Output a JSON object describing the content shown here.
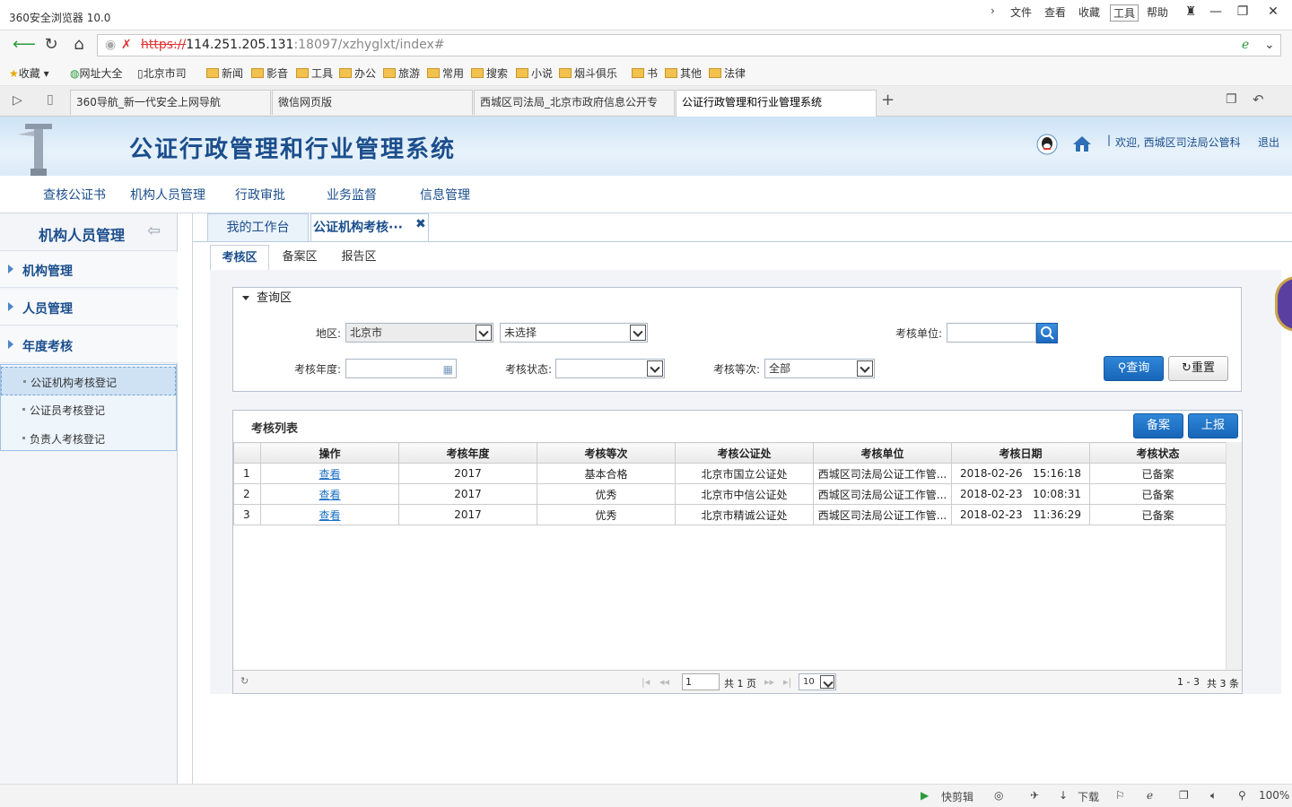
{
  "browser": {
    "title": "360安全浏览器 10.0",
    "menu": [
      "文件",
      "查看",
      "收藏",
      "工具",
      "帮助"
    ],
    "url_scheme": "https://",
    "url_host": "114.251.205.131",
    "url_rest": ":18097/xzhyglxt/index#",
    "bookmarks": [
      "收藏",
      "网址大全",
      "北京市司",
      "新闻",
      "影音",
      "工具",
      "办公",
      "旅游",
      "常用",
      "搜索",
      "小说",
      "烟斗俱乐",
      "书",
      "其他",
      "法律"
    ],
    "tabs": [
      "360导航_新一代安全上网导航",
      "微信网页版",
      "西城区司法局_北京市政府信息公开专",
      "公证行政管理和行业管理系统"
    ],
    "status": {
      "clip": "快剪辑",
      "download": "下载",
      "zoom": "100%"
    }
  },
  "app": {
    "system_title": "公证行政管理和行业管理系统",
    "welcome": "欢迎, 西城区司法局公管科",
    "logout": "退出",
    "nav": [
      "查核公证书",
      "机构人员管理",
      "行政审批",
      "业务监督",
      "信息管理"
    ]
  },
  "sidebar": {
    "title": "机构人员管理",
    "groups": [
      "机构管理",
      "人员管理",
      "年度考核"
    ],
    "items": [
      "公证机构考核登记",
      "公证员考核登记",
      "负责人考核登记"
    ]
  },
  "worktabs": {
    "home": "我的工作台",
    "current": "公证机构考核···"
  },
  "subtabs": [
    "考核区",
    "备案区",
    "报告区"
  ],
  "query": {
    "title": "查询区",
    "region_label": "地区:",
    "region_value": "北京市",
    "region2_value": "未选择",
    "unit_label": "考核单位:",
    "year_label": "考核年度:",
    "status_label": "考核状态:",
    "grade_label": "考核等次:",
    "grade_value": "全部",
    "search_btn": "查询",
    "reset_btn": "重置"
  },
  "list": {
    "title": "考核列表",
    "file_btn": "备案",
    "report_btn": "上报",
    "columns": [
      "操作",
      "考核年度",
      "考核等次",
      "考核公证处",
      "考核单位",
      "考核日期",
      "考核状态"
    ],
    "rows": [
      {
        "no": "1",
        "op": "查看",
        "year": "2017",
        "grade": "基本合格",
        "office": "北京市国立公证处",
        "unit": "西城区司法局公证工作管...",
        "date": "2018-02-26   15:16:18",
        "status": "已备案"
      },
      {
        "no": "2",
        "op": "查看",
        "year": "2017",
        "grade": "优秀",
        "office": "北京市中信公证处",
        "unit": "西城区司法局公证工作管...",
        "date": "2018-02-23   10:08:31",
        "status": "已备案"
      },
      {
        "no": "3",
        "op": "查看",
        "year": "2017",
        "grade": "优秀",
        "office": "北京市精诚公证处",
        "unit": "西城区司法局公证工作管...",
        "date": "2018-02-23   11:36:29",
        "status": "已备案"
      }
    ],
    "pager": {
      "page": "1",
      "total_pages": "共 1 页",
      "page_size": "10",
      "range": "1 - 3",
      "total": "共 3 条"
    }
  }
}
